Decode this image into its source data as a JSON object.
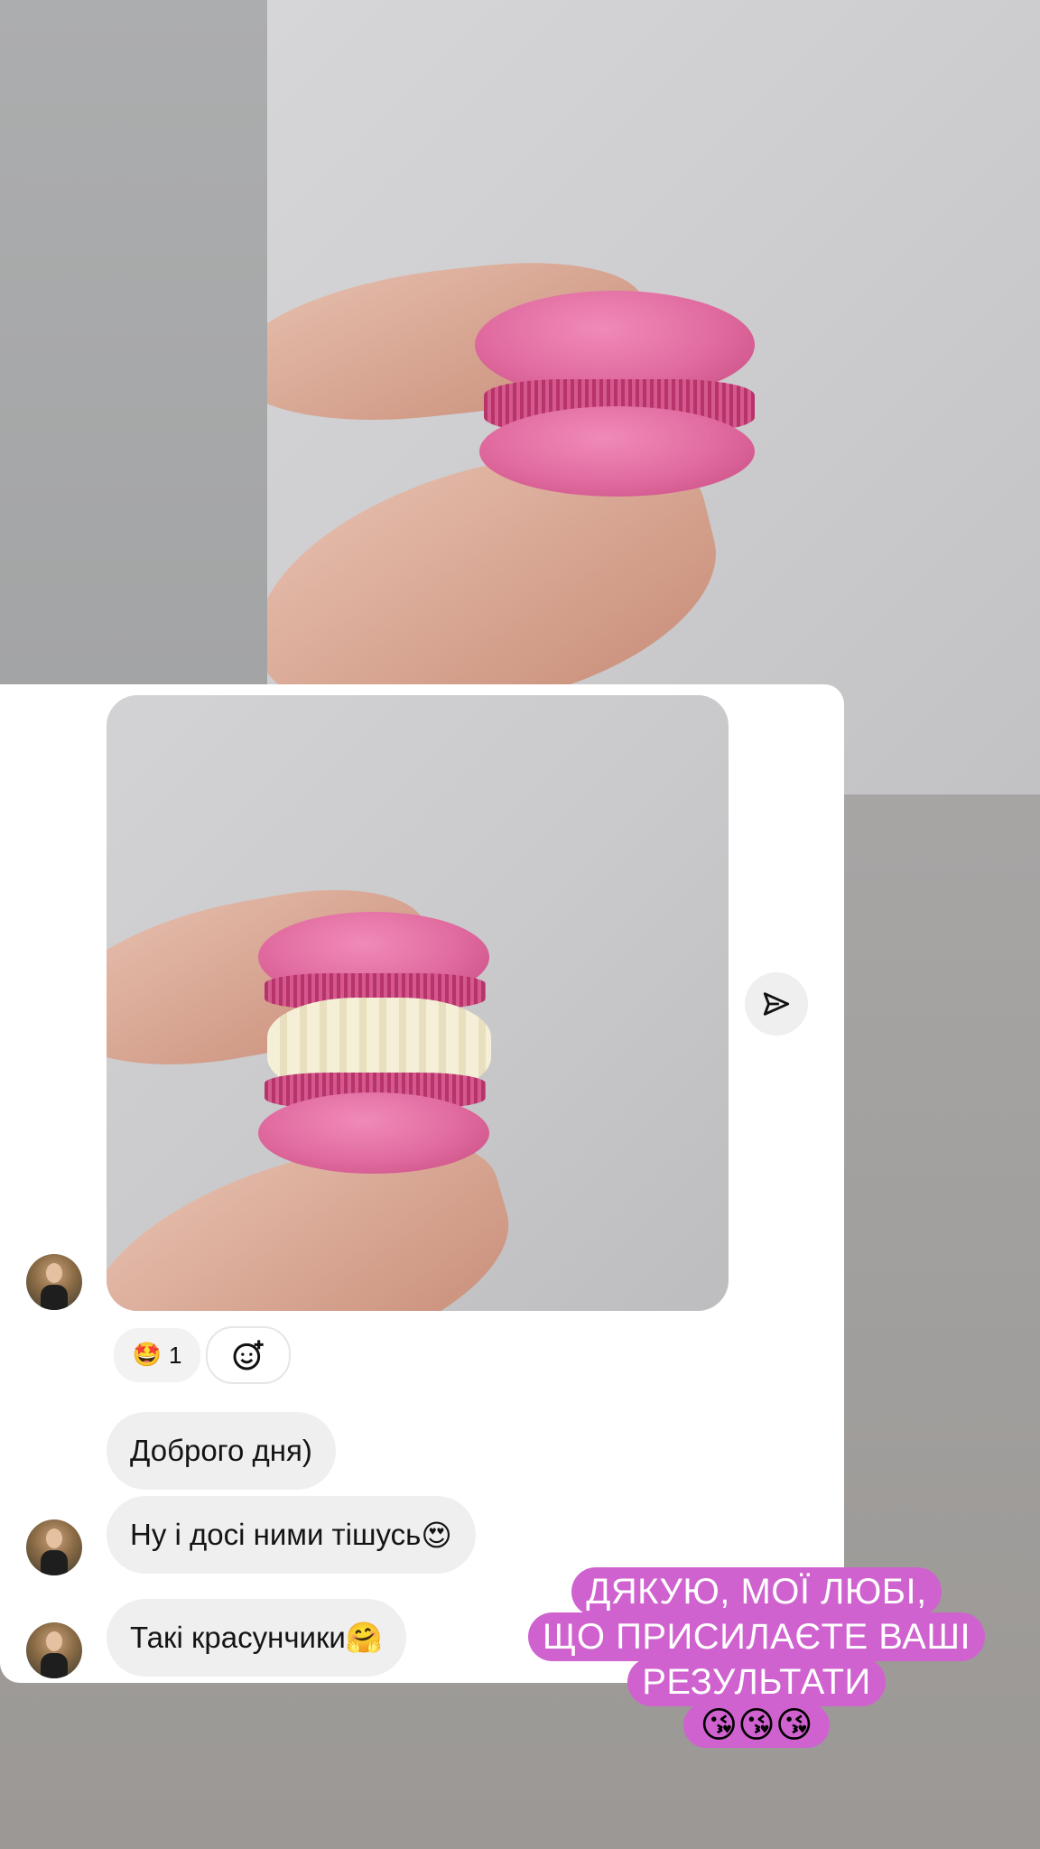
{
  "story": {
    "reaction": {
      "emoji": "🤩",
      "count": "1"
    },
    "messages": [
      {
        "text": "Доброго дня)"
      },
      {
        "text": "Ну і досі ними тішусь",
        "emoji": "😍"
      },
      {
        "text": "Такі красунчики",
        "emoji": "🤗"
      }
    ],
    "caption": {
      "lines": [
        "ДЯКУЮ, МОЇ ЛЮБІ,",
        "ЩО ПРИСИЛАЄТЕ ВАШІ",
        "РЕЗУЛЬТАТИ"
      ],
      "emojis": "😘😘😘",
      "background_color": "#cf62cf"
    }
  }
}
